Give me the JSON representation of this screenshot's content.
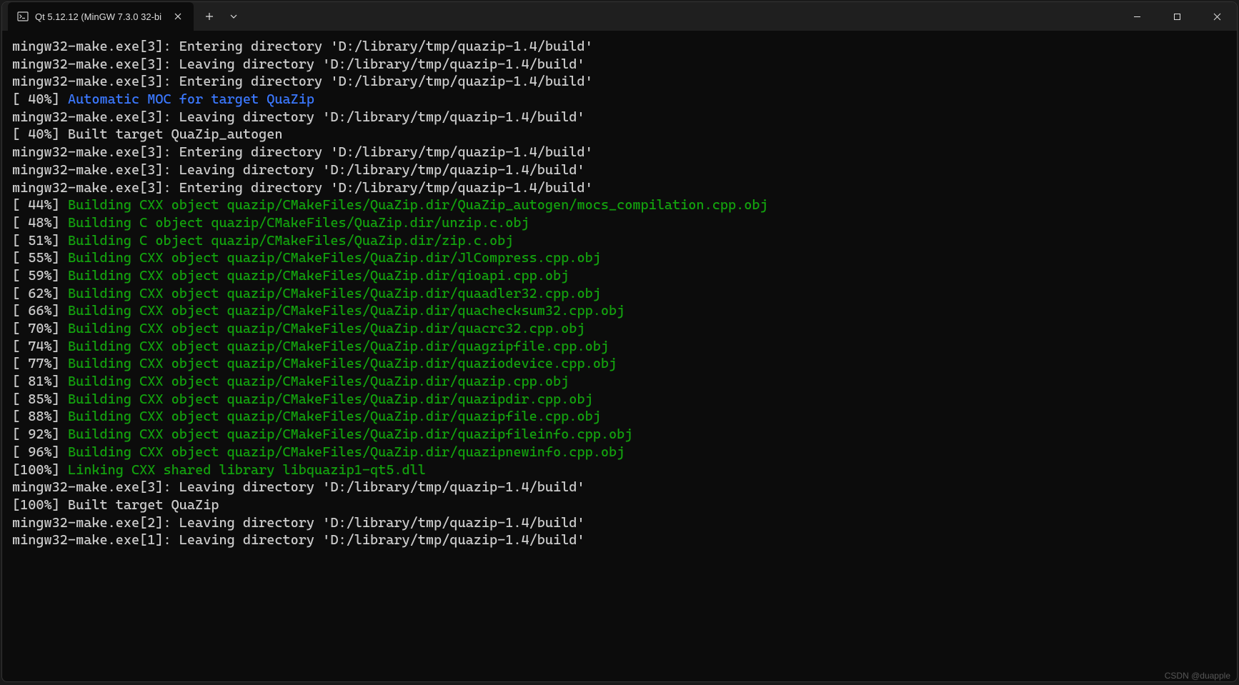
{
  "window": {
    "tab_title": "Qt 5.12.12 (MinGW 7.3.0 32-bi",
    "watermark": "CSDN @duapple"
  },
  "lines": [
    {
      "segments": [
        {
          "cls": "white",
          "t": "mingw32-make.exe[3]: Entering directory 'D:/library/tmp/quazip-1.4/build'"
        }
      ]
    },
    {
      "segments": [
        {
          "cls": "white",
          "t": "mingw32-make.exe[3]: Leaving directory 'D:/library/tmp/quazip-1.4/build'"
        }
      ]
    },
    {
      "segments": [
        {
          "cls": "white",
          "t": "mingw32-make.exe[3]: Entering directory 'D:/library/tmp/quazip-1.4/build'"
        }
      ]
    },
    {
      "segments": [
        {
          "cls": "white",
          "t": "[ 40%] "
        },
        {
          "cls": "blue",
          "t": "Automatic MOC for target QuaZip"
        }
      ]
    },
    {
      "segments": [
        {
          "cls": "white",
          "t": "mingw32-make.exe[3]: Leaving directory 'D:/library/tmp/quazip-1.4/build'"
        }
      ]
    },
    {
      "segments": [
        {
          "cls": "white",
          "t": "[ 40%] Built target QuaZip_autogen"
        }
      ]
    },
    {
      "segments": [
        {
          "cls": "white",
          "t": "mingw32-make.exe[3]: Entering directory 'D:/library/tmp/quazip-1.4/build'"
        }
      ]
    },
    {
      "segments": [
        {
          "cls": "white",
          "t": "mingw32-make.exe[3]: Leaving directory 'D:/library/tmp/quazip-1.4/build'"
        }
      ]
    },
    {
      "segments": [
        {
          "cls": "white",
          "t": "mingw32-make.exe[3]: Entering directory 'D:/library/tmp/quazip-1.4/build'"
        }
      ]
    },
    {
      "segments": [
        {
          "cls": "white",
          "t": "[ 44%] "
        },
        {
          "cls": "green",
          "t": "Building CXX object quazip/CMakeFiles/QuaZip.dir/QuaZip_autogen/mocs_compilation.cpp.obj"
        }
      ]
    },
    {
      "segments": [
        {
          "cls": "white",
          "t": "[ 48%] "
        },
        {
          "cls": "green",
          "t": "Building C object quazip/CMakeFiles/QuaZip.dir/unzip.c.obj"
        }
      ]
    },
    {
      "segments": [
        {
          "cls": "white",
          "t": "[ 51%] "
        },
        {
          "cls": "green",
          "t": "Building C object quazip/CMakeFiles/QuaZip.dir/zip.c.obj"
        }
      ]
    },
    {
      "segments": [
        {
          "cls": "white",
          "t": "[ 55%] "
        },
        {
          "cls": "green",
          "t": "Building CXX object quazip/CMakeFiles/QuaZip.dir/JlCompress.cpp.obj"
        }
      ]
    },
    {
      "segments": [
        {
          "cls": "white",
          "t": "[ 59%] "
        },
        {
          "cls": "green",
          "t": "Building CXX object quazip/CMakeFiles/QuaZip.dir/qioapi.cpp.obj"
        }
      ]
    },
    {
      "segments": [
        {
          "cls": "white",
          "t": "[ 62%] "
        },
        {
          "cls": "green",
          "t": "Building CXX object quazip/CMakeFiles/QuaZip.dir/quaadler32.cpp.obj"
        }
      ]
    },
    {
      "segments": [
        {
          "cls": "white",
          "t": "[ 66%] "
        },
        {
          "cls": "green",
          "t": "Building CXX object quazip/CMakeFiles/QuaZip.dir/quachecksum32.cpp.obj"
        }
      ]
    },
    {
      "segments": [
        {
          "cls": "white",
          "t": "[ 70%] "
        },
        {
          "cls": "green",
          "t": "Building CXX object quazip/CMakeFiles/QuaZip.dir/quacrc32.cpp.obj"
        }
      ]
    },
    {
      "segments": [
        {
          "cls": "white",
          "t": "[ 74%] "
        },
        {
          "cls": "green",
          "t": "Building CXX object quazip/CMakeFiles/QuaZip.dir/quagzipfile.cpp.obj"
        }
      ]
    },
    {
      "segments": [
        {
          "cls": "white",
          "t": "[ 77%] "
        },
        {
          "cls": "green",
          "t": "Building CXX object quazip/CMakeFiles/QuaZip.dir/quaziodevice.cpp.obj"
        }
      ]
    },
    {
      "segments": [
        {
          "cls": "white",
          "t": "[ 81%] "
        },
        {
          "cls": "green",
          "t": "Building CXX object quazip/CMakeFiles/QuaZip.dir/quazip.cpp.obj"
        }
      ]
    },
    {
      "segments": [
        {
          "cls": "white",
          "t": "[ 85%] "
        },
        {
          "cls": "green",
          "t": "Building CXX object quazip/CMakeFiles/QuaZip.dir/quazipdir.cpp.obj"
        }
      ]
    },
    {
      "segments": [
        {
          "cls": "white",
          "t": "[ 88%] "
        },
        {
          "cls": "green",
          "t": "Building CXX object quazip/CMakeFiles/QuaZip.dir/quazipfile.cpp.obj"
        }
      ]
    },
    {
      "segments": [
        {
          "cls": "white",
          "t": "[ 92%] "
        },
        {
          "cls": "green",
          "t": "Building CXX object quazip/CMakeFiles/QuaZip.dir/quazipfileinfo.cpp.obj"
        }
      ]
    },
    {
      "segments": [
        {
          "cls": "white",
          "t": "[ 96%] "
        },
        {
          "cls": "green",
          "t": "Building CXX object quazip/CMakeFiles/QuaZip.dir/quazipnewinfo.cpp.obj"
        }
      ]
    },
    {
      "segments": [
        {
          "cls": "white",
          "t": "[100%] "
        },
        {
          "cls": "green",
          "t": "Linking CXX shared library libquazip1-qt5.dll"
        }
      ]
    },
    {
      "segments": [
        {
          "cls": "white",
          "t": "mingw32-make.exe[3]: Leaving directory 'D:/library/tmp/quazip-1.4/build'"
        }
      ]
    },
    {
      "segments": [
        {
          "cls": "white",
          "t": "[100%] Built target QuaZip"
        }
      ]
    },
    {
      "segments": [
        {
          "cls": "white",
          "t": "mingw32-make.exe[2]: Leaving directory 'D:/library/tmp/quazip-1.4/build'"
        }
      ]
    },
    {
      "segments": [
        {
          "cls": "white",
          "t": "mingw32-make.exe[1]: Leaving directory 'D:/library/tmp/quazip-1.4/build'"
        }
      ]
    }
  ]
}
